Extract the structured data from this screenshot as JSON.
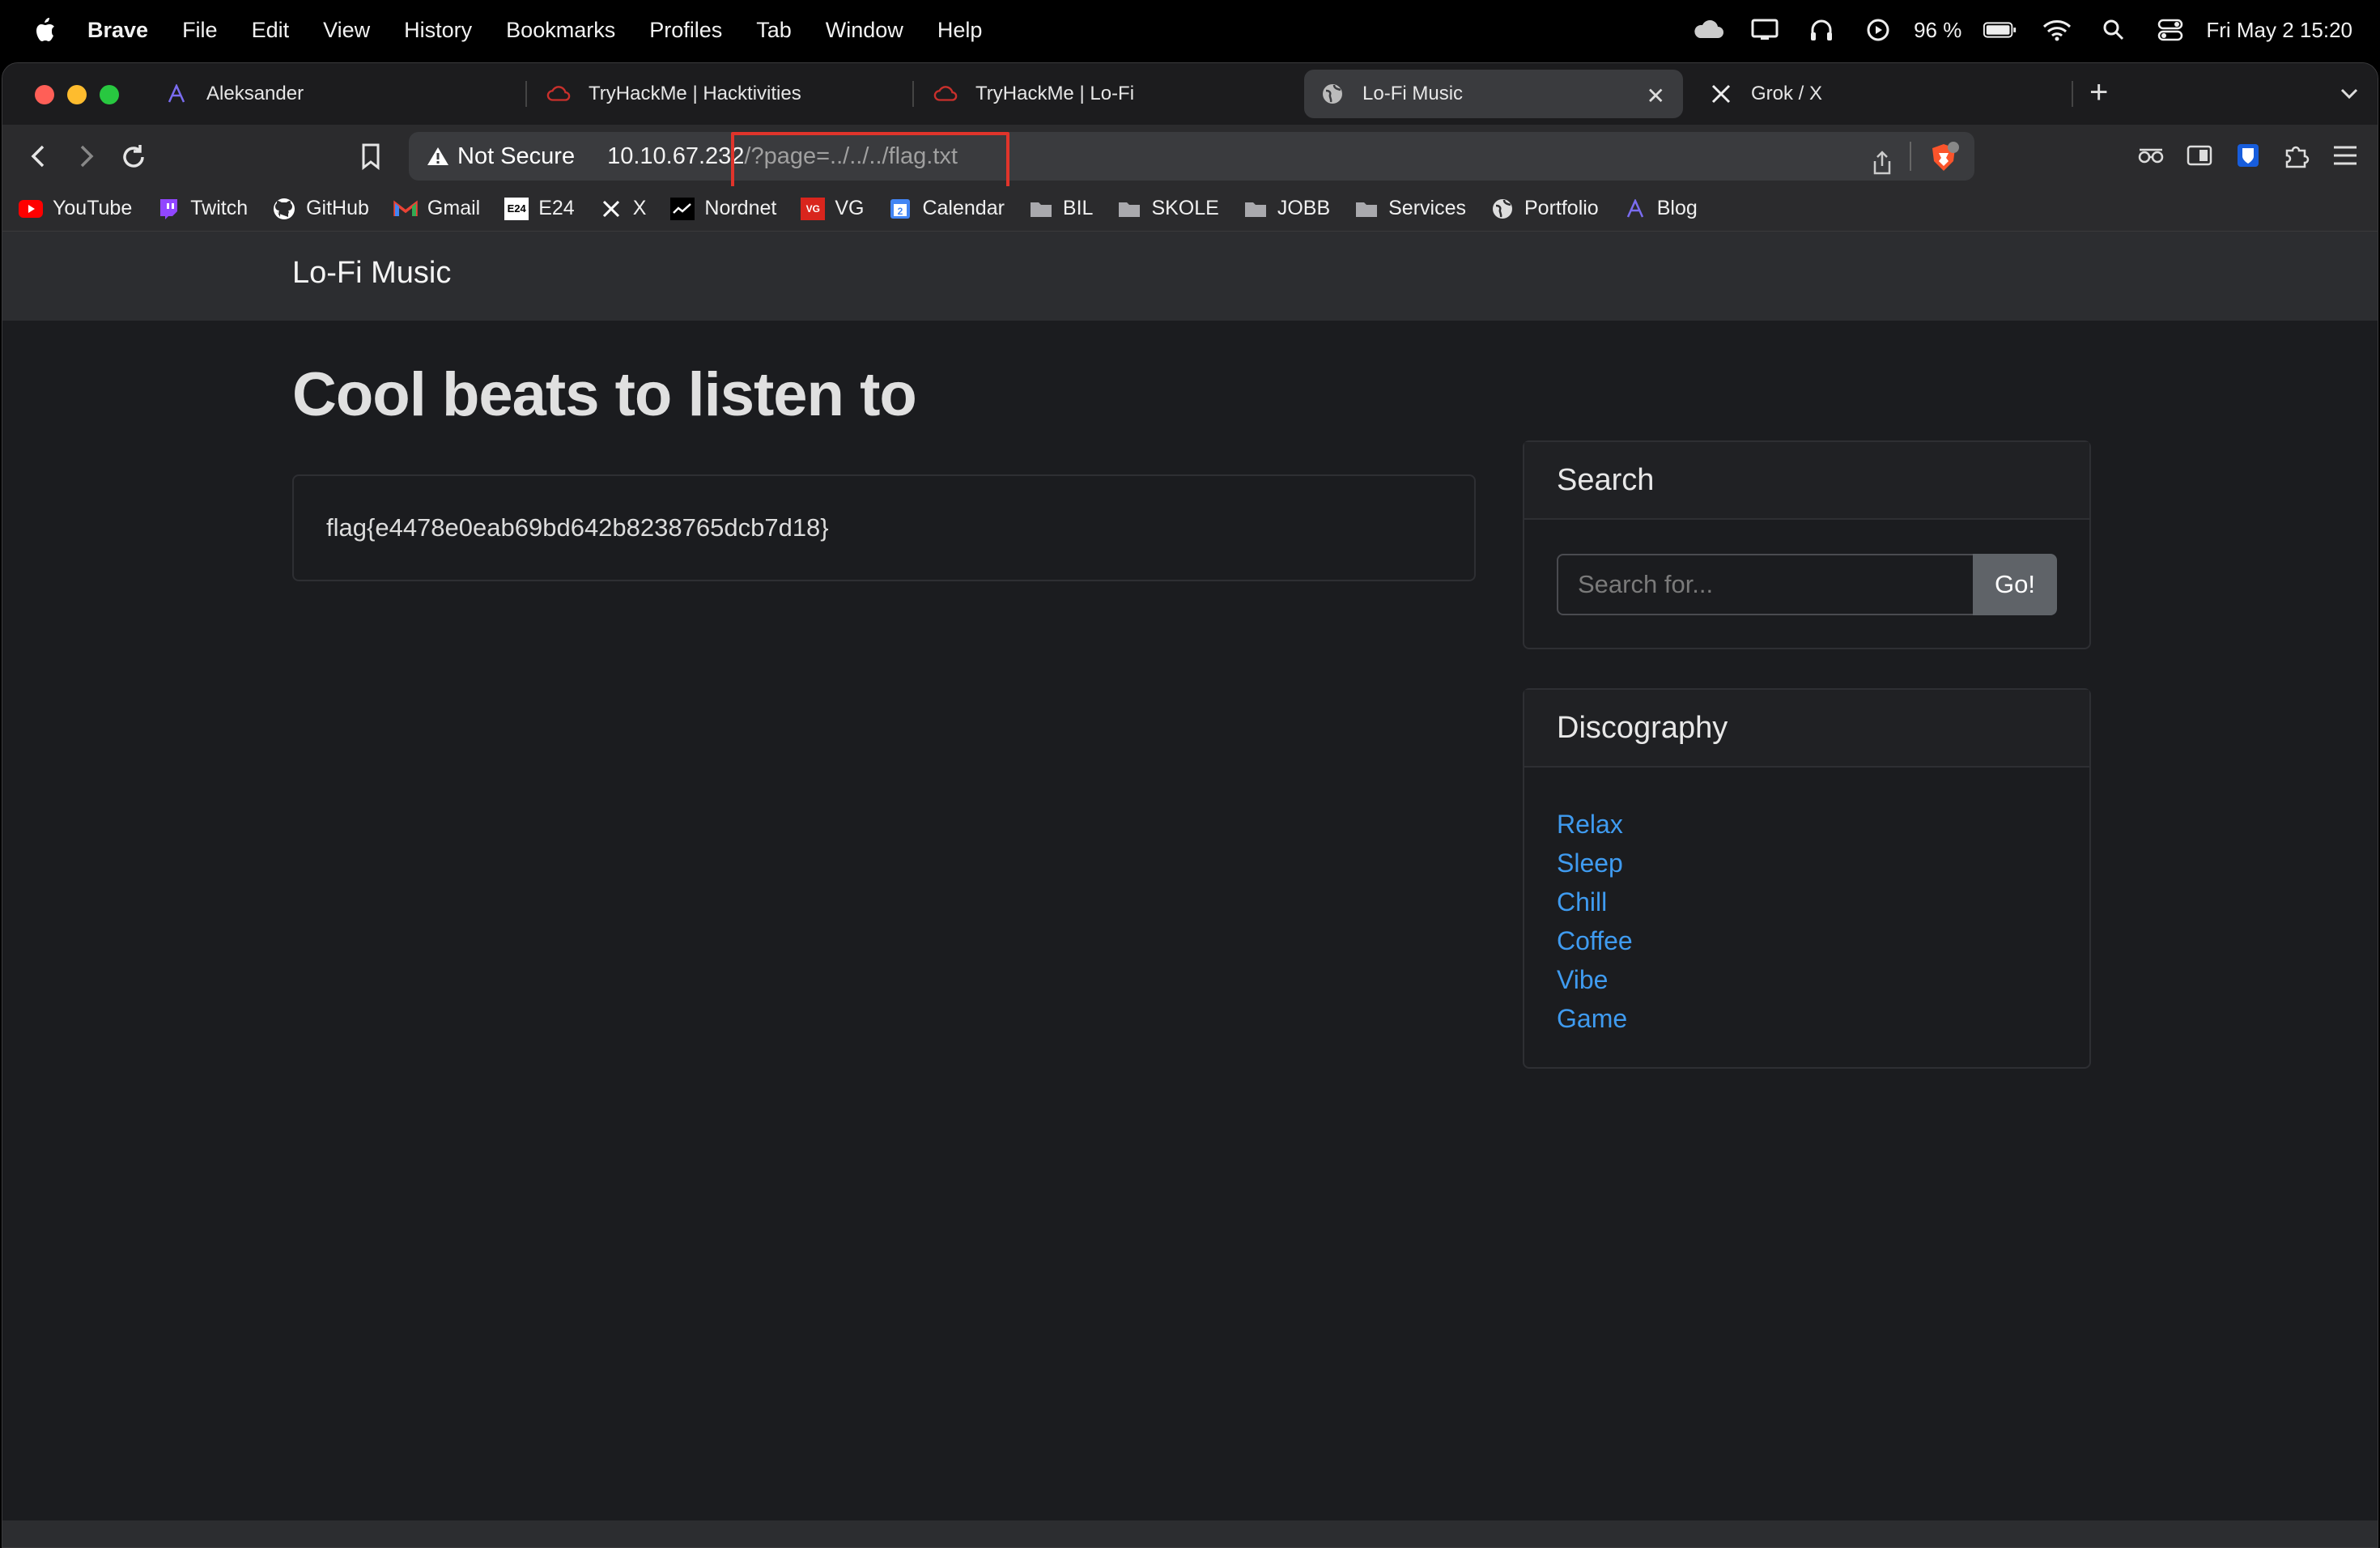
{
  "menubar": {
    "app": "Brave",
    "items": [
      "File",
      "Edit",
      "View",
      "History",
      "Bookmarks",
      "Profiles",
      "Tab",
      "Window",
      "Help"
    ],
    "battery": "96 %",
    "datetime": "Fri May 2  15:20"
  },
  "tabs": [
    {
      "title": "Aleksander"
    },
    {
      "title": "TryHackMe | Hacktivities"
    },
    {
      "title": "TryHackMe | Lo-Fi"
    },
    {
      "title": "Lo-Fi Music"
    },
    {
      "title": "Grok / X"
    }
  ],
  "address": {
    "security": "Not Secure",
    "host": "10.10.67.232",
    "path": "/?page=../../../flag.txt"
  },
  "bookmarks": [
    {
      "label": "YouTube"
    },
    {
      "label": "Twitch"
    },
    {
      "label": "GitHub"
    },
    {
      "label": "Gmail"
    },
    {
      "label": "E24"
    },
    {
      "label": "X"
    },
    {
      "label": "Nordnet"
    },
    {
      "label": "VG"
    },
    {
      "label": "Calendar"
    },
    {
      "label": "BIL"
    },
    {
      "label": "SKOLE"
    },
    {
      "label": "JOBB"
    },
    {
      "label": "Services"
    },
    {
      "label": "Portfolio"
    },
    {
      "label": "Blog"
    }
  ],
  "site": {
    "brand": "Lo-Fi Music",
    "heading": "Cool beats to listen to",
    "flag": "flag{e4478e0eab69bd642b8238765dcb7d18}",
    "search": {
      "title": "Search",
      "placeholder": "Search for...",
      "button": "Go!"
    },
    "discography": {
      "title": "Discography",
      "items": [
        "Relax",
        "Sleep",
        "Chill",
        "Coffee",
        "Vibe",
        "Game"
      ]
    }
  },
  "colors": {
    "link": "#3f9bf0",
    "highlight": "#e0342b",
    "page_bg": "#1b1c1f"
  }
}
